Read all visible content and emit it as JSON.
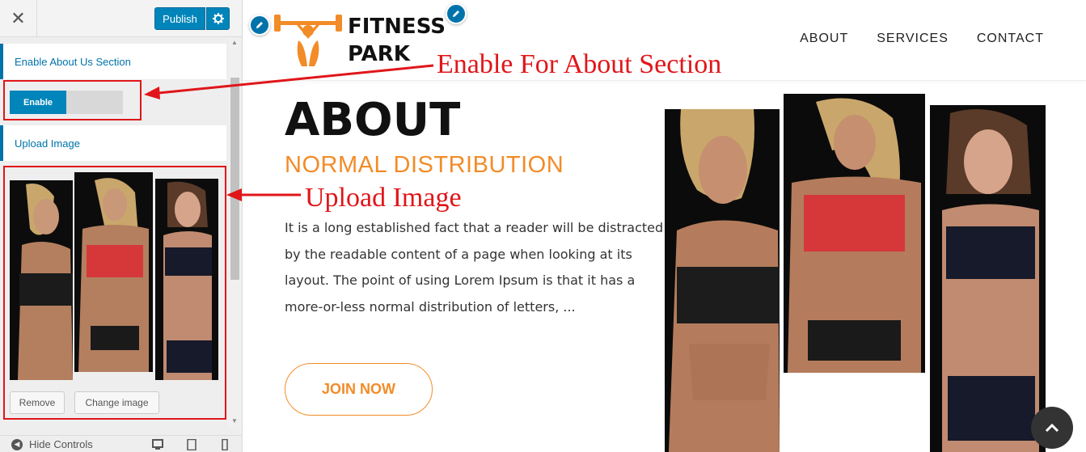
{
  "customizer": {
    "close_label": "✕",
    "publish_label": "Publish",
    "sections": {
      "about_toggle_title": "Enable About Us Section",
      "toggle_label": "Enable",
      "upload_title": "Upload Image"
    },
    "buttons": {
      "remove": "Remove",
      "change": "Change image"
    },
    "footer": {
      "hide_controls": "Hide Controls",
      "devices": [
        "desktop-icon",
        "tablet-icon",
        "mobile-icon"
      ]
    }
  },
  "site": {
    "logo": {
      "line1": "FITNESS",
      "line2": "PARK"
    },
    "nav": [
      "ABOUT",
      "SERVICES",
      "CONTACT"
    ],
    "about": {
      "heading": "ABOUT",
      "subheading": "NORMAL DISTRIBUTION",
      "body": "It is a long established fact that a reader will be distracted by the readable content of a page when looking at its layout. The point of using Lorem Ipsum is that it has a more-or-less normal distribution of letters, ...",
      "cta": "JOIN NOW"
    }
  },
  "annotations": {
    "enable": "Enable For About Section",
    "upload": "Upload Image"
  },
  "colors": {
    "wp_blue": "#0085ba",
    "accent_orange": "#f28c28",
    "annotation_red": "#e0161a"
  }
}
